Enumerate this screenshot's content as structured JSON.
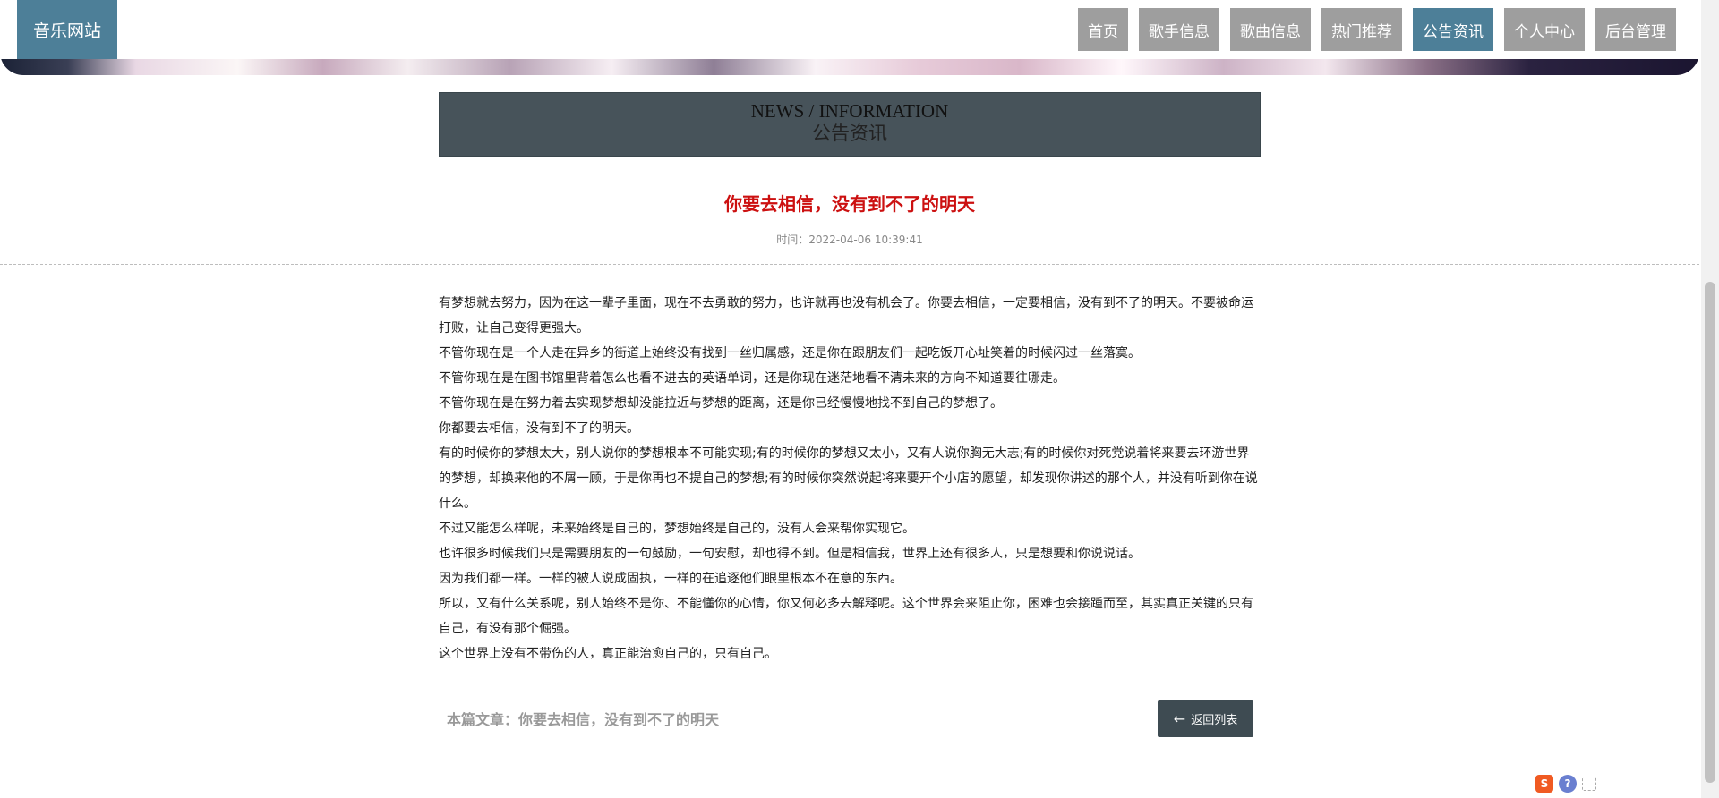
{
  "site": {
    "logo": "音乐网站"
  },
  "nav": {
    "items": [
      {
        "label": "首页"
      },
      {
        "label": "歌手信息"
      },
      {
        "label": "歌曲信息"
      },
      {
        "label": "热门推荐"
      },
      {
        "label": "公告资讯",
        "active": true
      },
      {
        "label": "个人中心"
      },
      {
        "label": "后台管理"
      }
    ]
  },
  "section": {
    "title_en": "NEWS / INFORMATION",
    "title_zh": "公告资讯"
  },
  "article": {
    "title": "你要去相信，没有到不了的明天",
    "time": "时间：2022-04-06 10:39:41",
    "paragraphs": [
      "有梦想就去努力，因为在这一辈子里面，现在不去勇敢的努力，也许就再也没有机会了。你要去相信，一定要相信，没有到不了的明天。不要被命运打败，让自己变得更强大。",
      "不管你现在是一个人走在异乡的街道上始终没有找到一丝归属感，还是你在跟朋友们一起吃饭开心址笑着的时候闪过一丝落寞。",
      "不管你现在是在图书馆里背着怎么也看不进去的英语单词，还是你现在迷茫地看不清未来的方向不知道要往哪走。",
      "不管你现在是在努力着去实现梦想却没能拉近与梦想的距离，还是你已经慢慢地找不到自己的梦想了。",
      "你都要去相信，没有到不了的明天。",
      "有的时候你的梦想太大，别人说你的梦想根本不可能实现;有的时候你的梦想又太小，又有人说你胸无大志;有的时候你对死党说着将来要去环游世界的梦想，却换来他的不屑一顾，于是你再也不提自己的梦想;有的时候你突然说起将来要开个小店的愿望，却发现你讲述的那个人，并没有听到你在说什么。",
      "不过又能怎么样呢，未来始终是自己的，梦想始终是自己的，没有人会来帮你实现它。",
      "也许很多时候我们只是需要朋友的一句鼓励，一句安慰，却也得不到。但是相信我，世界上还有很多人，只是想要和你说说话。",
      "因为我们都一样。一样的被人说成固执，一样的在追逐他们眼里根本不在意的东西。",
      "所以，又有什么关系呢，别人始终不是你、不能懂你的心情，你又何必多去解释呢。这个世界会来阻止你，困难也会接踵而至，其实真正关键的只有自己，有没有那个倔强。",
      "这个世界上没有不带伤的人，真正能治愈自己的，只有自己。"
    ],
    "footer_label": "本篇文章：你要去相信，没有到不了的明天",
    "back_button": "返回列表"
  },
  "icons": {
    "back": "arrow-left-icon",
    "tools": [
      "sogou-icon",
      "help-icon",
      "expand-icon"
    ]
  }
}
